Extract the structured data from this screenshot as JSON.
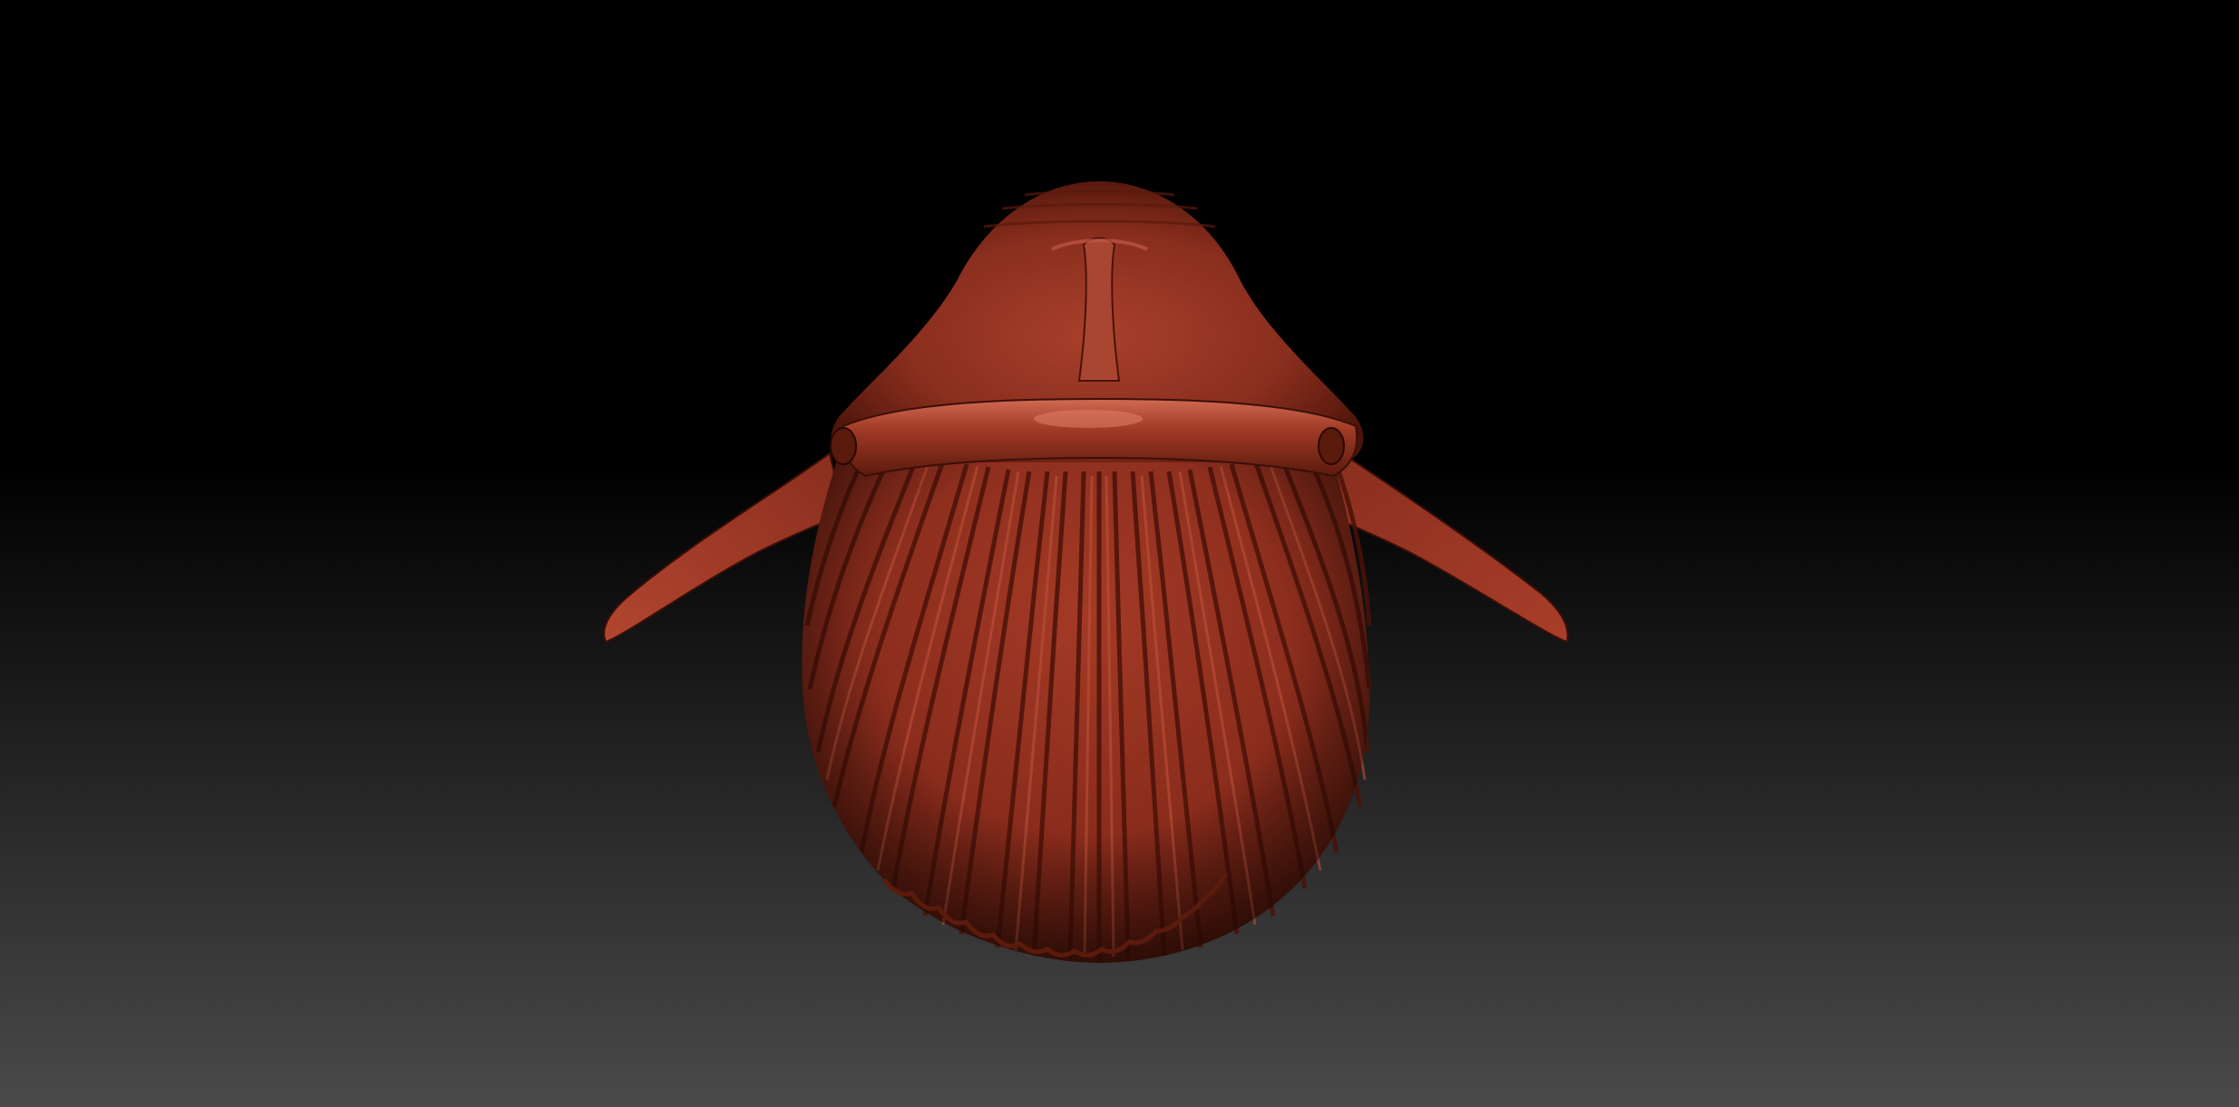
{
  "scene": {
    "backdrop_top_color": "#000000",
    "backdrop_horizon_color": "#0a0a0a",
    "backdrop_bottom_color": "#4a4a4a",
    "material_base_color": "#8f3020",
    "material_highlight_color": "#c8604a",
    "material_shadow_color": "#3a0f08",
    "model_subject": "ribbed-shell-whale-sculpt"
  }
}
